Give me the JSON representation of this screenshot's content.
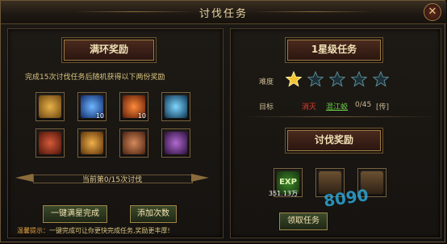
{
  "window": {
    "title": "讨伐任务",
    "close_label": "✕",
    "help_label": "?"
  },
  "left": {
    "banner": "满环奖励",
    "description": "完成15次讨伐任务后随机获得以下两份奖励",
    "rewards": [
      {
        "icon": "gold-ingot-icon",
        "count": ""
      },
      {
        "icon": "blue-orb-icon",
        "count": "10"
      },
      {
        "icon": "fire-stone-icon",
        "count": "10"
      },
      {
        "icon": "azure-sphere-icon",
        "count": ""
      },
      {
        "icon": "gift-pouch-icon",
        "count": ""
      },
      {
        "icon": "beer-mug-icon",
        "count": ""
      },
      {
        "icon": "bronze-ball-icon",
        "count": ""
      },
      {
        "icon": "winged-emblem-icon",
        "count": ""
      }
    ],
    "progress_label": "当前第0/15次讨伐",
    "progress_value": 0,
    "complete_button": "一键满星完成",
    "add_times_button": "添加次数",
    "tip_prefix": "温馨提示：",
    "tip_text": "一键完成可让你更快完成任务,奖励更丰厚!"
  },
  "right": {
    "banner": "1星级任务",
    "difficulty_label": "难度",
    "stars_filled": 1,
    "stars_total": 5,
    "target_label": "目标",
    "target_action": "消灭",
    "target_name": "混江蛟",
    "target_progress": "0/45",
    "target_goto": "[传]",
    "reward_banner": "讨伐奖励",
    "exp_label": "EXP",
    "exp_value": "351.13万",
    "claim_button": "领取任务",
    "watermark": "8090"
  },
  "colors": {
    "accent": "#9c7a45",
    "highlight": "#d9c57e",
    "red_text": "#e04030",
    "green_text": "#6ccf4a"
  }
}
